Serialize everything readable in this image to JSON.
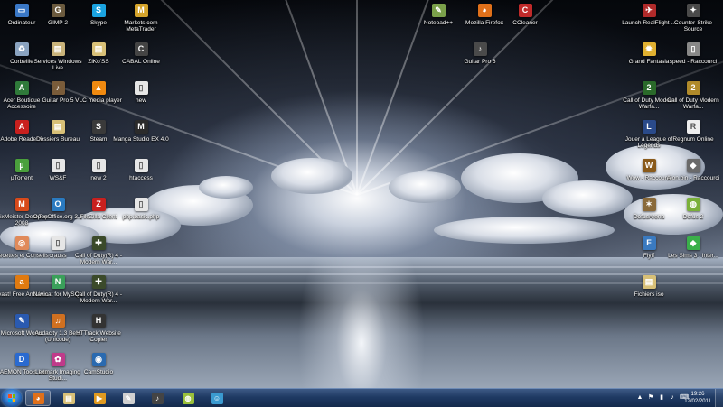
{
  "desktop": {
    "icons": [
      {
        "label": "Ordinateur",
        "icon": "computer-icon",
        "color": "#3a78c7",
        "glyph": "▭"
      },
      {
        "label": "GIMP 2",
        "icon": "gimp-icon",
        "color": "#6b5a3e",
        "glyph": "G"
      },
      {
        "label": "Skype",
        "icon": "skype-icon",
        "color": "#1aa3e0",
        "glyph": "S"
      },
      {
        "label": "Markets.com MetaTrader",
        "icon": "metatrader-icon",
        "color": "#d4a32b",
        "glyph": "M"
      },
      {
        "label": "Corbeille",
        "icon": "recycle-bin-icon",
        "color": "#8aa3c0",
        "glyph": "♻"
      },
      {
        "label": "Services Windows Live",
        "icon": "windows-live-icon",
        "color": "#c9b37a",
        "glyph": "▤"
      },
      {
        "label": "ZiKo'SS",
        "icon": "folder-icon",
        "color": "#d8c077",
        "glyph": "▤"
      },
      {
        "label": "CABAL Online",
        "icon": "cabal-icon",
        "color": "#444444",
        "glyph": "C"
      },
      {
        "label": "Acer Boutique Accessoire",
        "icon": "acer-icon",
        "color": "#2f7a3a",
        "glyph": "A"
      },
      {
        "label": "Guitar Pro 5",
        "icon": "guitar-pro-icon",
        "color": "#7a5c3a",
        "glyph": "♪"
      },
      {
        "label": "VLC media player",
        "icon": "vlc-icon",
        "color": "#f08a10",
        "glyph": "▲"
      },
      {
        "label": "new",
        "icon": "file-icon",
        "color": "#e6e6e6",
        "glyph": "▯"
      },
      {
        "label": "Adobe Reader 9",
        "icon": "adobe-reader-icon",
        "color": "#c8201e",
        "glyph": "A"
      },
      {
        "label": "Dossiers Bureau",
        "icon": "folder-icon",
        "color": "#d8c077",
        "glyph": "▤"
      },
      {
        "label": "Steam",
        "icon": "steam-icon",
        "color": "#3a3a3a",
        "glyph": "S"
      },
      {
        "label": "Manga Studio EX 4.0",
        "icon": "manga-studio-icon",
        "color": "#2b2b2b",
        "glyph": "M"
      },
      {
        "label": "µTorrent",
        "icon": "utorrent-icon",
        "color": "#4aa03c",
        "glyph": "µ"
      },
      {
        "label": "WS&F",
        "icon": "file-icon",
        "color": "#e6e6e6",
        "glyph": "▯"
      },
      {
        "label": "new 2",
        "icon": "file-icon",
        "color": "#e6e6e6",
        "glyph": "▯"
      },
      {
        "label": "htaccess",
        "icon": "file-icon",
        "color": "#e6e6e6",
        "glyph": "▯"
      },
      {
        "label": "MixMeister DeskTop 2008",
        "icon": "mixmeister-icon",
        "color": "#d84a1a",
        "glyph": "M"
      },
      {
        "label": "OpenOffice.org 3.2",
        "icon": "openoffice-icon",
        "color": "#2a7ac0",
        "glyph": "O"
      },
      {
        "label": "FileZilla Client",
        "icon": "filezilla-icon",
        "color": "#c8201e",
        "glyph": "Z"
      },
      {
        "label": "php.basic.php",
        "icon": "file-icon",
        "color": "#e6e6e6",
        "glyph": "▯"
      },
      {
        "label": "Recettes et Conseils",
        "icon": "recipes-icon",
        "color": "#e08a5a",
        "glyph": "◎"
      },
      {
        "label": "crauss",
        "icon": "file-icon",
        "color": "#e6e6e6",
        "glyph": "▯"
      },
      {
        "label": "Call of Duty(R) 4 - Modern War...",
        "icon": "call-of-duty-icon",
        "color": "#3b4a2a",
        "glyph": "✚"
      },
      {
        "label": "avast! Free Antivirus",
        "icon": "avast-icon",
        "color": "#e07a10",
        "glyph": "a"
      },
      {
        "label": "Navicat for MySQL",
        "icon": "navicat-icon",
        "color": "#3aa05a",
        "glyph": "N"
      },
      {
        "label": "Call of Duty(R) 4 - Modern War...",
        "icon": "call-of-duty-icon",
        "color": "#3b4a2a",
        "glyph": "✚"
      },
      {
        "label": "Microsoft Works",
        "icon": "microsoft-works-icon",
        "color": "#2a5ab0",
        "glyph": "✎"
      },
      {
        "label": "Audacity 1.3 Beta (Unicode)",
        "icon": "audacity-icon",
        "color": "#d07020",
        "glyph": "♫"
      },
      {
        "label": "HTTrack Website Copier",
        "icon": "httrack-icon",
        "color": "#333333",
        "glyph": "H"
      },
      {
        "label": "DAEMON Tools Lite",
        "icon": "daemon-tools-icon",
        "color": "#2a6ad0",
        "glyph": "D"
      },
      {
        "label": "Lexmark Imaging Studi...",
        "icon": "lexmark-icon",
        "color": "#c03a8a",
        "glyph": "✿"
      },
      {
        "label": "CamStudio",
        "icon": "camstudio-icon",
        "color": "#2a6ab0",
        "glyph": "◉"
      },
      {
        "label": "Notepad++",
        "icon": "notepad-plus-plus-icon",
        "color": "#7aa04a",
        "glyph": "✎"
      },
      {
        "label": "Mozilla Firefox",
        "icon": "firefox-icon",
        "color": "#e0701a",
        "glyph": "◕"
      },
      {
        "label": "CCleaner",
        "icon": "ccleaner-icon",
        "color": "#c02a2a",
        "glyph": "C"
      },
      {
        "label": "Guitar Pro 6",
        "icon": "guitar-pro-icon",
        "color": "#4a4a4a",
        "glyph": "♪"
      },
      {
        "label": "Launch RealFlight ...",
        "icon": "realflight-icon",
        "color": "#b02a2a",
        "glyph": "✈"
      },
      {
        "label": "Counter-Strike Source",
        "icon": "counter-strike-icon",
        "color": "#4a4a4a",
        "glyph": "✦"
      },
      {
        "label": "Grand Fantasia",
        "icon": "grand-fantasia-icon",
        "color": "#e0b030",
        "glyph": "✹"
      },
      {
        "label": "speed - Raccourci",
        "icon": "speed-icon",
        "color": "#888888",
        "glyph": "▯"
      },
      {
        "label": "Call of Duty Modern Warfa...",
        "icon": "call-of-duty-2-icon",
        "color": "#2a6a2a",
        "glyph": "2"
      },
      {
        "label": "Call of Duty Modern Warfa...",
        "icon": "call-of-duty-2-icon",
        "color": "#b08a2a",
        "glyph": "2"
      },
      {
        "label": "Jouer à League of Legends",
        "icon": "league-of-legends-icon",
        "color": "#2a4a8a",
        "glyph": "L"
      },
      {
        "label": "Regnum Online",
        "icon": "regnum-icon",
        "color": "#eeeeee",
        "glyph": "R"
      },
      {
        "label": "Wow - Raccourci",
        "icon": "wow-icon",
        "color": "#8a5a1a",
        "glyph": "W"
      },
      {
        "label": "Aion.bin - Raccourci",
        "icon": "aion-icon",
        "color": "#6a6a6a",
        "glyph": "◆"
      },
      {
        "label": "DofusArena",
        "icon": "dofus-arena-icon",
        "color": "#8a6a3a",
        "glyph": "✶"
      },
      {
        "label": "Dofus 2",
        "icon": "dofus-icon",
        "color": "#7ab03a",
        "glyph": "◍"
      },
      {
        "label": "Flyff",
        "icon": "flyff-icon",
        "color": "#3a7ac0",
        "glyph": "F"
      },
      {
        "label": "Les Sims 3 : Inter...",
        "icon": "sims-icon",
        "color": "#3ab04a",
        "glyph": "◆"
      },
      {
        "label": "Fichiers iso",
        "icon": "folder-icon",
        "color": "#d8c077",
        "glyph": "▤"
      }
    ]
  },
  "taskbar": {
    "pinned": [
      {
        "name": "firefox-taskbar-button",
        "icon": "firefox-icon",
        "color": "#e0701a",
        "glyph": "◕",
        "active": true
      },
      {
        "name": "explorer-taskbar-button",
        "icon": "folder-icon",
        "color": "#d8c077",
        "glyph": "▤",
        "active": false
      },
      {
        "name": "media-player-taskbar-button",
        "icon": "media-player-icon",
        "color": "#e09a20",
        "glyph": "▶",
        "active": false
      },
      {
        "name": "notepad-taskbar-button",
        "icon": "notepad-icon",
        "color": "#d0d0d0",
        "glyph": "✎",
        "active": false
      },
      {
        "name": "guitar-pro-taskbar-button",
        "icon": "guitar-pro-icon",
        "color": "#444444",
        "glyph": "♪",
        "active": false
      },
      {
        "name": "dofus-taskbar-button",
        "icon": "dofus-icon",
        "color": "#9ac03a",
        "glyph": "◍",
        "active": false
      },
      {
        "name": "messenger-taskbar-button",
        "icon": "messenger-icon",
        "color": "#3a9ad0",
        "glyph": "☺",
        "active": false
      }
    ],
    "tray_icons": [
      "chevron-up-icon",
      "flag-icon",
      "network-icon",
      "volume-icon",
      "keyboard-icon"
    ],
    "tray_glyphs": [
      "▲",
      "⚑",
      "▮",
      "♪",
      "⌨"
    ],
    "clock": {
      "time": "19:26",
      "date": "12/02/2011"
    }
  }
}
